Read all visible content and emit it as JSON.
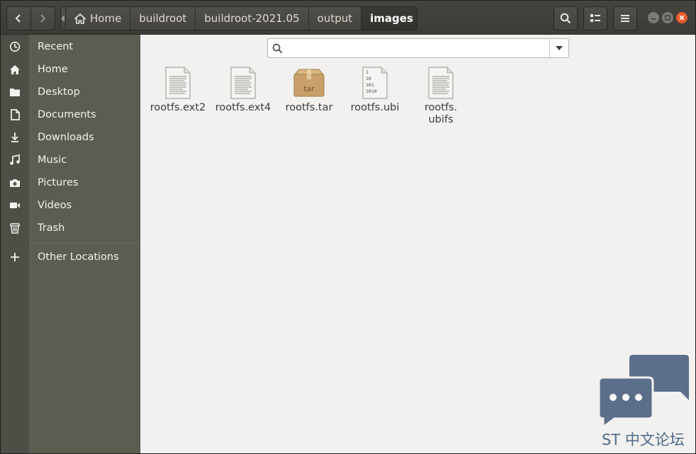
{
  "window": {
    "pathbar": {
      "crumbs": [
        {
          "label": "Home"
        },
        {
          "label": "buildroot"
        },
        {
          "label": "buildroot-2021.05"
        },
        {
          "label": "output"
        },
        {
          "label": "images"
        }
      ],
      "active_index": 4
    },
    "icons": {
      "back": "chevron-left-icon",
      "forward": "chevron-right-icon",
      "search": "search-icon",
      "view": "view-list-icon",
      "menu": "hamburger-menu-icon",
      "minimize": "minimize-icon",
      "maximize": "maximize-icon",
      "close": "close-icon"
    }
  },
  "sidebar": {
    "items": [
      {
        "label": "Recent",
        "icon": "clock-icon"
      },
      {
        "label": "Home",
        "icon": "home-icon"
      },
      {
        "label": "Desktop",
        "icon": "folder-icon"
      },
      {
        "label": "Documents",
        "icon": "document-icon"
      },
      {
        "label": "Downloads",
        "icon": "download-icon"
      },
      {
        "label": "Music",
        "icon": "music-icon"
      },
      {
        "label": "Pictures",
        "icon": "camera-icon"
      },
      {
        "label": "Videos",
        "icon": "video-icon"
      },
      {
        "label": "Trash",
        "icon": "trash-icon"
      },
      {
        "label": "Other Locations",
        "icon": "plus-icon"
      }
    ]
  },
  "search": {
    "placeholder": "",
    "value": ""
  },
  "files": [
    {
      "name": "rootfs.ext2",
      "type": "text-file-icon"
    },
    {
      "name": "rootfs.ext4",
      "type": "text-file-icon"
    },
    {
      "name": "rootfs.tar",
      "type": "tar-archive-icon",
      "badge": "tar"
    },
    {
      "name": "rootfs.ubi",
      "type": "binary-file-icon",
      "binary_lines": [
        "1",
        "10",
        "101",
        "1010"
      ]
    },
    {
      "name": "rootfs.\nubifs",
      "type": "text-file-icon"
    }
  ],
  "watermark": {
    "text": "ST 中文论坛"
  },
  "colors": {
    "accent_close": "#e9592c",
    "sidebar_bg": "#5c5c53",
    "header_bg": "#3c3b37",
    "content_bg": "#f2f1f0"
  }
}
